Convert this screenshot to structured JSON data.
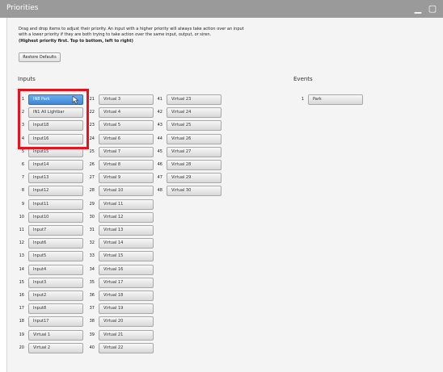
{
  "window": {
    "title": "Priorities"
  },
  "description": {
    "line1": "Drag and drop items to adjust their priority. An input with a higher priority will always take action over an input",
    "line2": "with a lower priority if they are both trying to take action over the same input, output, or siren.",
    "line3": "(Highest priority first. Top to bottom, left to right)"
  },
  "restore_label": "Restore Defaults",
  "inputs_label": "Inputs",
  "events_label": "Events",
  "inputs": [
    {
      "num": "1",
      "label": "IN8 Park"
    },
    {
      "num": "2",
      "label": "IN1 All Lightbar"
    },
    {
      "num": "3",
      "label": "Input18"
    },
    {
      "num": "4",
      "label": "Input16"
    },
    {
      "num": "5",
      "label": "Input15"
    },
    {
      "num": "6",
      "label": "Input14"
    },
    {
      "num": "7",
      "label": "Input13"
    },
    {
      "num": "8",
      "label": "Input12"
    },
    {
      "num": "9",
      "label": "Input11"
    },
    {
      "num": "10",
      "label": "Input10"
    },
    {
      "num": "11",
      "label": "Input7"
    },
    {
      "num": "12",
      "label": "Input6"
    },
    {
      "num": "13",
      "label": "Input5"
    },
    {
      "num": "14",
      "label": "Input4"
    },
    {
      "num": "15",
      "label": "Input3"
    },
    {
      "num": "16",
      "label": "Input2"
    },
    {
      "num": "17",
      "label": "Input8"
    },
    {
      "num": "18",
      "label": "Input17"
    },
    {
      "num": "19",
      "label": "Virtual 1"
    },
    {
      "num": "20",
      "label": "Virtual 2"
    },
    {
      "num": "21",
      "label": "Virtual 3"
    },
    {
      "num": "22",
      "label": "Virtual 4"
    },
    {
      "num": "23",
      "label": "Virtual 5"
    },
    {
      "num": "24",
      "label": "Virtual 6"
    },
    {
      "num": "25",
      "label": "Virtual 7"
    },
    {
      "num": "26",
      "label": "Virtual 8"
    },
    {
      "num": "27",
      "label": "Virtual 9"
    },
    {
      "num": "28",
      "label": "Virtual 10"
    },
    {
      "num": "29",
      "label": "Virtual 11"
    },
    {
      "num": "30",
      "label": "Virtual 12"
    },
    {
      "num": "31",
      "label": "Virtual 13"
    },
    {
      "num": "32",
      "label": "Virtual 14"
    },
    {
      "num": "33",
      "label": "Virtual 15"
    },
    {
      "num": "34",
      "label": "Virtual 16"
    },
    {
      "num": "35",
      "label": "Virtual 17"
    },
    {
      "num": "36",
      "label": "Virtual 18"
    },
    {
      "num": "37",
      "label": "Virtual 19"
    },
    {
      "num": "38",
      "label": "Virtual 20"
    },
    {
      "num": "39",
      "label": "Virtual 21"
    },
    {
      "num": "40",
      "label": "Virtual 22"
    },
    {
      "num": "41",
      "label": "Virtual 23"
    },
    {
      "num": "42",
      "label": "Virtual 24"
    },
    {
      "num": "43",
      "label": "Virtual 25"
    },
    {
      "num": "44",
      "label": "Virtual 26"
    },
    {
      "num": "45",
      "label": "Virtual 27"
    },
    {
      "num": "46",
      "label": "Virtual 28"
    },
    {
      "num": "47",
      "label": "Virtual 29"
    },
    {
      "num": "48",
      "label": "Virtual 30"
    }
  ],
  "events": [
    {
      "num": "1",
      "label": "Park"
    }
  ],
  "icons": {
    "minimize": "minimize-icon",
    "maximize": "maximize-icon",
    "cursor": "mouse-cursor-icon"
  },
  "colors": {
    "titlebar": "#9a9a9a",
    "selected": "#4a90e2",
    "highlight": "#e8121c"
  }
}
